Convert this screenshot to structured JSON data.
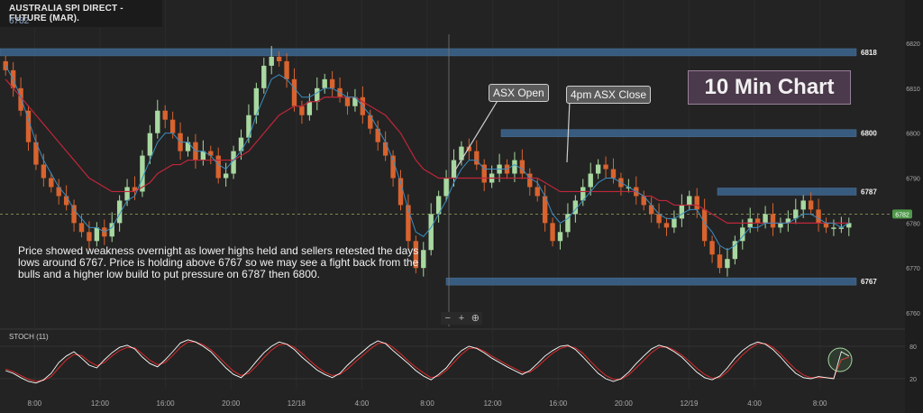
{
  "header": {
    "title": "AUSTRALIA SPI DIRECT - FUTURE (MAR).",
    "price": "6782"
  },
  "badge": "10 Min Chart",
  "callouts": {
    "open": "ASX Open",
    "close": "4pm ASX Close"
  },
  "annotation": "Price showed weakness overnight as lower highs held and sellers retested the days lows around 6767. Price is holding above 6767 so we may see a fight back from the bulls and a higher low build to put pressure on 6787 then 6800.",
  "zoom": {
    "minus": "−",
    "plus": "+",
    "fit": "⊕"
  },
  "stoch_label": "STOCH (11)",
  "colors": {
    "bull": "#a8d8a0",
    "bear": "#d9632e",
    "ma_fast": "#3b8ec2",
    "ma_slow": "#c0263a",
    "level": "#3f6f9e",
    "stoch_k": "#ffffff",
    "stoch_d": "#d92a2a"
  },
  "chart_data": {
    "type": "candlestick",
    "interval": "10 min",
    "ylim": [
      6757,
      6822
    ],
    "y_ticks": [
      6760,
      6770,
      6780,
      6790,
      6800,
      6810,
      6820
    ],
    "x_ticks": [
      "8:00",
      "12:00",
      "16:00",
      "20:00",
      "12/18",
      "4:00",
      "8:00",
      "12:00",
      "16:00",
      "20:00",
      "12/19",
      "4:00",
      "8:00"
    ],
    "levels": [
      6818,
      6800,
      6787,
      6767
    ],
    "last_price": 6782,
    "close": [
      6814,
      6810,
      6805,
      6798,
      6793,
      6790,
      6788,
      6786,
      6784,
      6780,
      6778,
      6776,
      6779,
      6777,
      6780,
      6785,
      6788,
      6787,
      6795,
      6800,
      6805,
      6803,
      6800,
      6796,
      6798,
      6794,
      6796,
      6795,
      6790,
      6791,
      6796,
      6799,
      6804,
      6810,
      6815,
      6817,
      6816,
      6812,
      6806,
      6804,
      6807,
      6810,
      6812,
      6810,
      6808,
      6806,
      6808,
      6804,
      6801,
      6798,
      6795,
      6790,
      6784,
      6776,
      6770,
      6774,
      6782,
      6786,
      6790,
      6794,
      6797,
      6796,
      6793,
      6789,
      6791,
      6793,
      6791,
      6794,
      6791,
      6788,
      6786,
      6780,
      6776,
      6778,
      6782,
      6785,
      6788,
      6791,
      6793,
      6792,
      6790,
      6788,
      6788,
      6786,
      6784,
      6782,
      6780,
      6779,
      6781,
      6784,
      6786,
      6783,
      6776,
      6773,
      6770,
      6772,
      6776,
      6779,
      6781,
      6780,
      6782,
      6779,
      6780,
      6781,
      6783,
      6785,
      6783,
      6780,
      6779,
      6779,
      6779,
      6780
    ],
    "ma_fast": [
      6815,
      6812,
      6808,
      6803,
      6798,
      6794,
      6791,
      6788,
      6786,
      6783,
      6781,
      6779,
      6779,
      6778,
      6779,
      6782,
      6785,
      6786,
      6790,
      6794,
      6798,
      6800,
      6800,
      6798,
      6798,
      6796,
      6796,
      6795,
      6793,
      6792,
      6794,
      6796,
      6799,
      6804,
      6808,
      6812,
      6813,
      6812,
      6810,
      6808,
      6808,
      6809,
      6810,
      6810,
      6809,
      6808,
      6808,
      6806,
      6804,
      6801,
      6798,
      6794,
      6789,
      6783,
      6778,
      6777,
      6779,
      6782,
      6785,
      6789,
      6792,
      6794,
      6794,
      6792,
      6792,
      6792,
      6792,
      6793,
      6792,
      6790,
      6789,
      6786,
      6782,
      6780,
      6781,
      6783,
      6785,
      6787,
      6789,
      6790,
      6790,
      6789,
      6788,
      6787,
      6786,
      6784,
      6782,
      6781,
      6781,
      6782,
      6783,
      6783,
      6780,
      6778,
      6775,
      6774,
      6775,
      6777,
      6779,
      6779,
      6780,
      6780,
      6780,
      6780,
      6781,
      6782,
      6782,
      6781,
      6780,
      6780,
      6779,
      6780
    ],
    "ma_slow": [
      6812,
      6810,
      6808,
      6806,
      6804,
      6802,
      6800,
      6798,
      6796,
      6794,
      6792,
      6790,
      6789,
      6788,
      6787,
      6787,
      6787,
      6787,
      6788,
      6789,
      6791,
      6792,
      6793,
      6793,
      6794,
      6794,
      6794,
      6794,
      6794,
      6794,
      6794,
      6795,
      6796,
      6798,
      6800,
      6802,
      6804,
      6805,
      6806,
      6806,
      6807,
      6807,
      6808,
      6808,
      6808,
      6808,
      6808,
      6807,
      6806,
      6805,
      6804,
      6802,
      6800,
      6797,
      6794,
      6792,
      6791,
      6790,
      6790,
      6790,
      6790,
      6790,
      6790,
      6790,
      6790,
      6790,
      6790,
      6790,
      6790,
      6790,
      6790,
      6789,
      6788,
      6787,
      6787,
      6787,
      6787,
      6787,
      6787,
      6787,
      6787,
      6787,
      6787,
      6787,
      6786,
      6786,
      6785,
      6785,
      6784,
      6784,
      6784,
      6784,
      6783,
      6782,
      6781,
      6780,
      6780,
      6780,
      6780,
      6780,
      6780,
      6780,
      6780,
      6780,
      6780,
      6780,
      6780,
      6780,
      6780,
      6780,
      6780,
      6780
    ],
    "stoch": {
      "ylim": [
        0,
        100
      ],
      "ticks": [
        20,
        80
      ],
      "k": [
        35,
        30,
        22,
        15,
        12,
        18,
        30,
        50,
        62,
        70,
        58,
        45,
        40,
        55,
        68,
        78,
        82,
        75,
        60,
        48,
        42,
        55,
        70,
        86,
        92,
        88,
        80,
        70,
        55,
        40,
        28,
        22,
        35,
        52,
        68,
        80,
        88,
        84,
        74,
        60,
        48,
        36,
        28,
        22,
        30,
        45,
        58,
        70,
        82,
        90,
        85,
        72,
        60,
        48,
        35,
        25,
        18,
        28,
        40,
        58,
        72,
        80,
        76,
        68,
        58,
        50,
        42,
        35,
        28,
        35,
        48,
        62,
        72,
        80,
        82,
        74,
        60,
        45,
        30,
        20,
        15,
        20,
        32,
        48,
        62,
        75,
        82,
        78,
        70,
        60,
        46,
        32,
        22,
        18,
        25,
        40,
        58,
        72,
        82,
        88,
        84,
        74,
        60,
        44,
        30,
        22,
        20,
        24,
        22,
        20,
        70,
        62
      ],
      "d": [
        38,
        33,
        26,
        19,
        15,
        17,
        24,
        40,
        55,
        65,
        63,
        52,
        44,
        50,
        62,
        72,
        78,
        77,
        66,
        54,
        46,
        50,
        63,
        78,
        88,
        88,
        83,
        74,
        61,
        47,
        34,
        26,
        30,
        43,
        59,
        73,
        83,
        84,
        78,
        67,
        54,
        42,
        32,
        26,
        28,
        38,
        51,
        63,
        75,
        85,
        86,
        78,
        66,
        53,
        41,
        31,
        22,
        25,
        35,
        50,
        65,
        76,
        77,
        71,
        62,
        54,
        46,
        39,
        32,
        32,
        42,
        55,
        67,
        76,
        80,
        77,
        67,
        52,
        38,
        26,
        19,
        19,
        27,
        40,
        54,
        68,
        78,
        79,
        73,
        64,
        52,
        39,
        28,
        21,
        22,
        33,
        49,
        64,
        76,
        85,
        85,
        78,
        66,
        51,
        37,
        27,
        22,
        22,
        22,
        21,
        55,
        60
      ]
    }
  }
}
